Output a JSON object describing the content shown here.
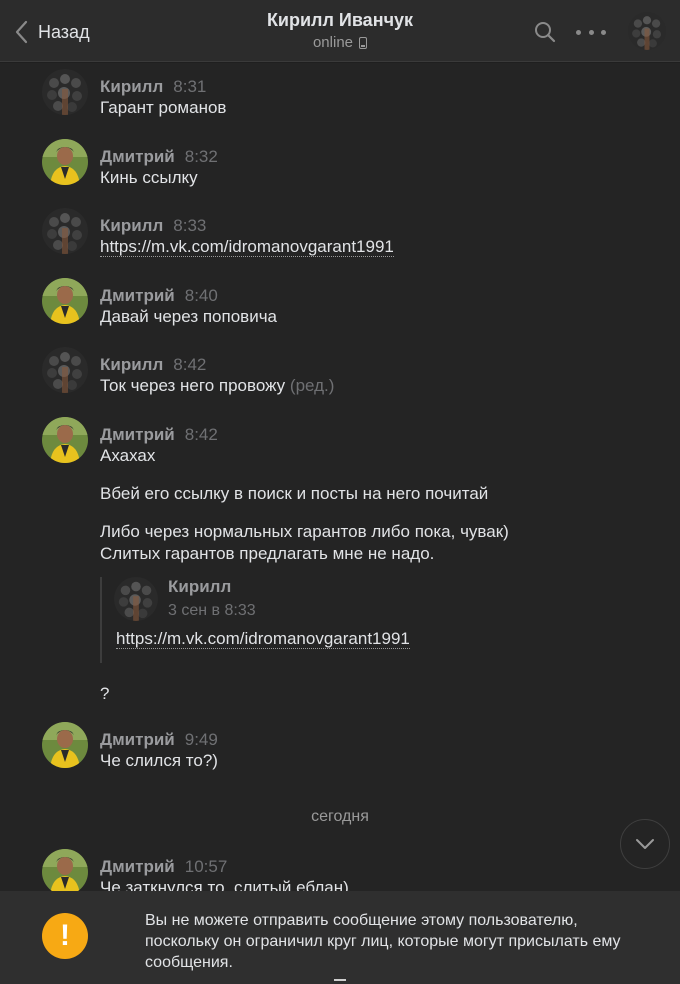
{
  "header": {
    "back_label": "Назад",
    "title": "Кирилл Иванчук",
    "status": "online"
  },
  "messages": [
    {
      "author": "Кирилл",
      "time": "8:31",
      "text": "Гарант романов"
    },
    {
      "author": "Дмитрий",
      "time": "8:32",
      "text": "Кинь ссылку"
    },
    {
      "author": "Кирилл",
      "time": "8:33",
      "link": "https://m.vk.com/idromanovgarant1991"
    },
    {
      "author": "Дмитрий",
      "time": "8:40",
      "text": "Давай через поповича"
    },
    {
      "author": "Кирилл",
      "time": "8:42",
      "text": "Ток через него провожу",
      "edited": "(ред.)"
    },
    {
      "author": "Дмитрий",
      "time": "8:42",
      "lines": [
        "Ахахах",
        "Вбей его ссылку в поиск и посты на него почитай",
        "Либо через нормальных гарантов либо пока, чувак)",
        "Слитых гарантов предлагать мне не надо."
      ],
      "forwarded": {
        "author": "Кирилл",
        "time": "3 сен в 8:33",
        "link": "https://m.vk.com/idromanovgarant1991"
      },
      "after": "?"
    },
    {
      "author": "Дмитрий",
      "time": "9:49",
      "text": "Че слился то?)"
    },
    {
      "author": "Дмитрий",
      "time": "10:57",
      "text": "Че заткнулся то, слитый еблан)"
    }
  ],
  "date_separator": "сегодня",
  "notice": {
    "icon": "!",
    "text": "Вы не можете отправить сообщение этому пользователю, поскольку он ограничил круг лиц, которые могут присылать ему сообщения."
  },
  "colors": {
    "background": "#242424",
    "header": "#2c2c2c",
    "warning": "#f7a914",
    "text": "#e1e3e6",
    "muted": "#6f7073"
  }
}
